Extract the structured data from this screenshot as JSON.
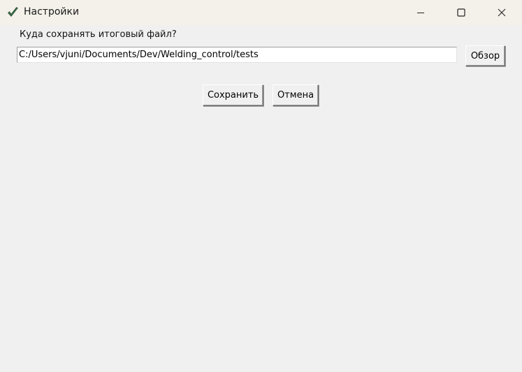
{
  "window": {
    "title": "Настройки",
    "app_icon": "checkmark-icon",
    "controls": {
      "minimize": "minimize-icon",
      "maximize": "maximize-icon",
      "close": "close-icon"
    }
  },
  "form": {
    "save_location_label": "Куда сохранять итоговый файл?",
    "path_value": "C:/Users/vjuni/Documents/Dev/Welding_control/tests",
    "browse_label": "Обзор"
  },
  "actions": {
    "save_label": "Сохранить",
    "cancel_label": "Отмена"
  },
  "colors": {
    "background": "#f0f0f0",
    "titlebar": "#f4f1ea",
    "icon_green": "#3a6b46"
  }
}
